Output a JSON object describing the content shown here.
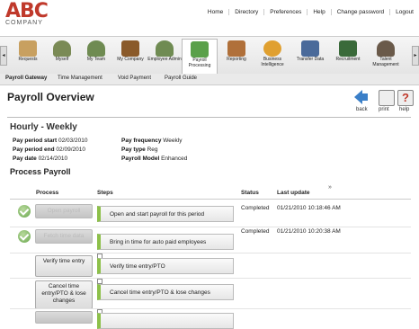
{
  "header": {
    "logo_main": "ABC",
    "logo_sub": "COMPANY",
    "links": [
      "Home",
      "Directory",
      "Preferences",
      "Help",
      "Change password",
      "Logout"
    ]
  },
  "modules": [
    {
      "label": "Requests",
      "color": "#c8a060"
    },
    {
      "label": "Myself",
      "color": "#7a8a55"
    },
    {
      "label": "My Team",
      "color": "#6f8b52"
    },
    {
      "label": "My Company",
      "color": "#8a5a2a"
    },
    {
      "label": "Employee Admin",
      "color": "#6f8b52"
    },
    {
      "label": "Payroll Processing",
      "color": "#5aa04a"
    },
    {
      "label": "Reporting",
      "color": "#b0703a"
    },
    {
      "label": "Business Intelligence",
      "color": "#e0a030"
    },
    {
      "label": "Transfer Data",
      "color": "#4a6a9a"
    },
    {
      "label": "Recruitment",
      "color": "#3a6a3a"
    },
    {
      "label": "Talent Management",
      "color": "#6a5a4a"
    }
  ],
  "subnav": [
    "Payroll Gateway",
    "Time Management",
    "Void Payment",
    "Payroll Guide"
  ],
  "page": {
    "title": "Payroll Overview",
    "icons": [
      {
        "label": "back",
        "icon": "back-arrow-icon",
        "color": "#3a7fc8"
      },
      {
        "label": "print",
        "icon": "printer-icon",
        "color": "#888888"
      },
      {
        "label": "help",
        "icon": "help-icon",
        "color": "#c0392b"
      }
    ]
  },
  "period": {
    "heading": "Hourly - Weekly",
    "fields": [
      {
        "k": "Pay period start",
        "v": "02/03/2010"
      },
      {
        "k": "Pay period end",
        "v": "02/09/2010"
      },
      {
        "k": "Pay date",
        "v": "02/14/2010"
      },
      {
        "k": "Pay frequency",
        "v": "Weekly"
      },
      {
        "k": "Pay type",
        "v": "Reg"
      },
      {
        "k": "Payroll Model",
        "v": "Enhanced"
      }
    ]
  },
  "process": {
    "heading": "Process Payroll",
    "columns": [
      "Process",
      "Steps",
      "Status",
      "Last update"
    ],
    "rows": [
      {
        "button": "Open payroll",
        "step": "Open and start payroll for this period",
        "status": "Completed",
        "updated": "01/21/2010 10:18:46 AM",
        "done": true
      },
      {
        "button": "Fetch time data",
        "step": "Bring in time for auto paid employees",
        "status": "Completed",
        "updated": "01/21/2010 10:20:38 AM",
        "done": true
      },
      {
        "button": "Verify time entry",
        "step": "Verify time entry/PTO",
        "status": "",
        "updated": "",
        "done": false
      },
      {
        "button": "Cancel time entry/PTO & lose changes",
        "step": "Cancel time entry/PTO & lose changes",
        "status": "",
        "updated": "",
        "done": false
      },
      {
        "button": "",
        "step": "",
        "status": "",
        "updated": "",
        "done": false
      }
    ]
  }
}
